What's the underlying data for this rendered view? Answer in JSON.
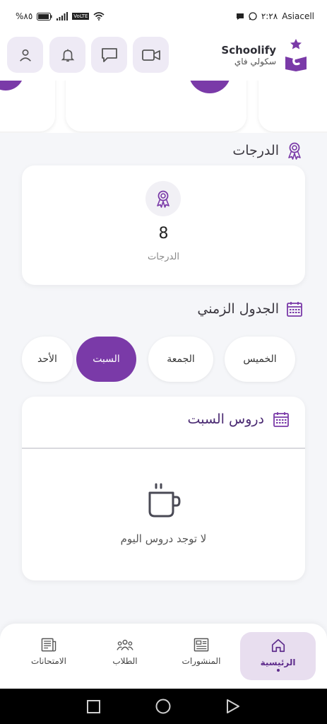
{
  "status": {
    "battery": "%٨٥",
    "time": "٢:٢٨",
    "carrier": "Asiacell",
    "volte": "VoLTE"
  },
  "brand": {
    "name": "Schoolify",
    "sub": "سكولي فاي"
  },
  "grades": {
    "title": "الدرجات",
    "value": "8",
    "label": "الدرجات"
  },
  "schedule": {
    "title": "الجدول الزمني",
    "days": [
      "الخميس",
      "الجمعة",
      "السبت",
      "الأحد"
    ],
    "selected": "السبت",
    "lessons_title": "دروس السبت",
    "empty_text": "لا توجد دروس اليوم"
  },
  "nav": {
    "items": [
      {
        "label": "الرئيسية",
        "icon": "home-icon",
        "active": true
      },
      {
        "label": "المنشورات",
        "icon": "posts-icon",
        "active": false
      },
      {
        "label": "الطلاب",
        "icon": "students-icon",
        "active": false
      },
      {
        "label": "الامتحانات",
        "icon": "exams-icon",
        "active": false
      }
    ]
  },
  "colors": {
    "accent": "#7a3aa8",
    "accent_light": "#eeeaf5",
    "background": "#f5f6f9"
  },
  "icons": [
    "profile-icon",
    "bell-icon",
    "chat-icon",
    "video-icon",
    "award-icon",
    "calendar-icon",
    "cup-icon"
  ]
}
